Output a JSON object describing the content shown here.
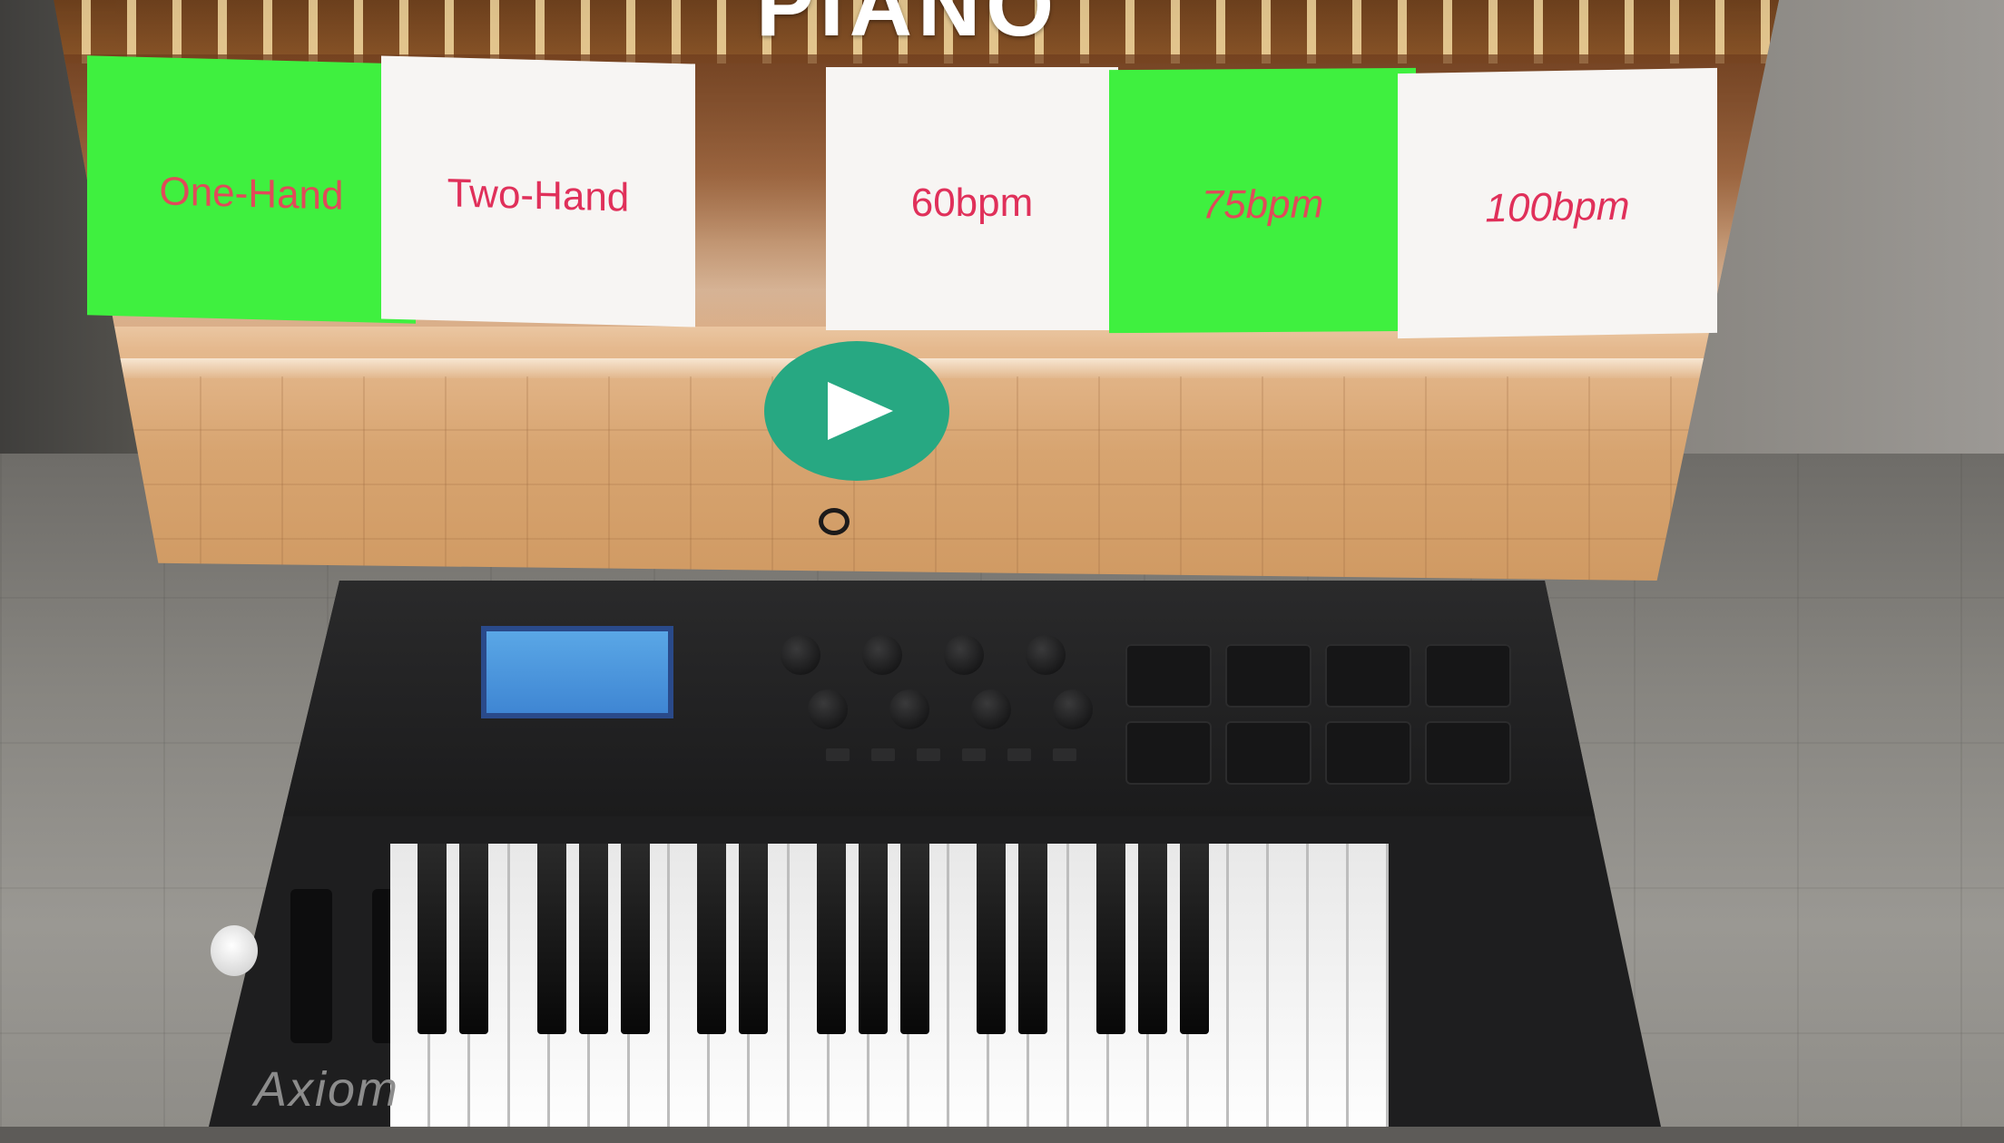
{
  "app": {
    "title": "PIANO"
  },
  "mode_options": [
    {
      "label": "One-Hand",
      "selected": true
    },
    {
      "label": "Two-Hand",
      "selected": false
    }
  ],
  "tempo_options": [
    {
      "label": "60bpm",
      "selected": false
    },
    {
      "label": "75bpm",
      "selected": true
    },
    {
      "label": "100bpm",
      "selected": false
    }
  ],
  "play": {
    "icon": "play-icon"
  },
  "controller": {
    "brand": "Axiom"
  },
  "colors": {
    "selected": "#3ff03f",
    "unselected": "#f7f5f3",
    "label": "#e0305a",
    "play": "#27a882"
  }
}
